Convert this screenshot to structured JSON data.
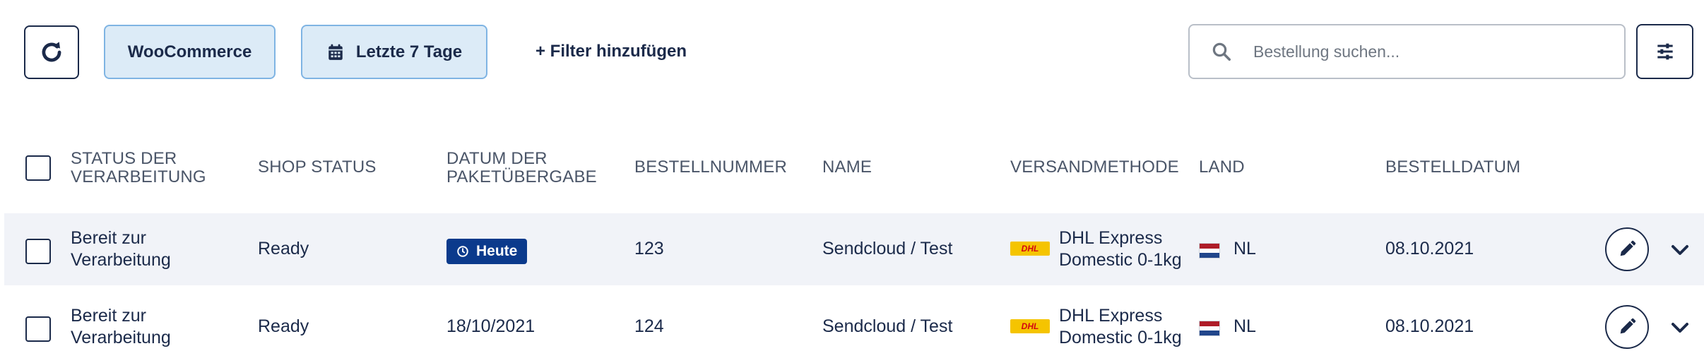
{
  "toolbar": {
    "refresh_icon": "refresh-icon",
    "filter_shop": "WooCommerce",
    "filter_date": "Letzte 7 Tage",
    "add_filter": "+ Filter hinzufügen",
    "search_placeholder": "Bestellung suchen...",
    "settings_icon": "sliders-icon"
  },
  "table": {
    "headers": {
      "status_line1": "STATUS DER",
      "status_line2": "VERARBEITUNG",
      "shop_status": "SHOP STATUS",
      "date_line1": "DATUM DER",
      "date_line2": "PAKETÜBERGABE",
      "order_number": "BESTELLNUMMER",
      "name": "NAME",
      "shipping_method": "VERSANDMETHODE",
      "country": "LAND",
      "order_date": "BESTELLDATUM"
    },
    "rows": [
      {
        "status_line1": "Bereit zur",
        "status_line2": "Verarbeitung",
        "shop_status": "Ready",
        "handover_date": "Heute",
        "handover_is_badge": true,
        "order_number": "123",
        "name": "Sendcloud / Test",
        "carrier_logo": "DHL",
        "shipping_line1": "DHL Express",
        "shipping_line2": "Domestic 0-1kg",
        "country": "NL",
        "order_date": "08.10.2021"
      },
      {
        "status_line1": "Bereit zur",
        "status_line2": "Verarbeitung",
        "shop_status": "Ready",
        "handover_date": "18/10/2021",
        "handover_is_badge": false,
        "order_number": "124",
        "name": "Sendcloud / Test",
        "carrier_logo": "DHL",
        "shipping_line1": "DHL Express",
        "shipping_line2": "Domestic 0-1kg",
        "country": "NL",
        "order_date": "08.10.2021"
      }
    ]
  },
  "colors": {
    "primary": "#1b2a4a",
    "chip_bg": "#dcebf7",
    "chip_border": "#7fb4e3",
    "badge_bg": "#0b3a8c",
    "row_highlight": "#f1f3f8",
    "dhl_yellow": "#f5c400",
    "dhl_red": "#d40511"
  }
}
